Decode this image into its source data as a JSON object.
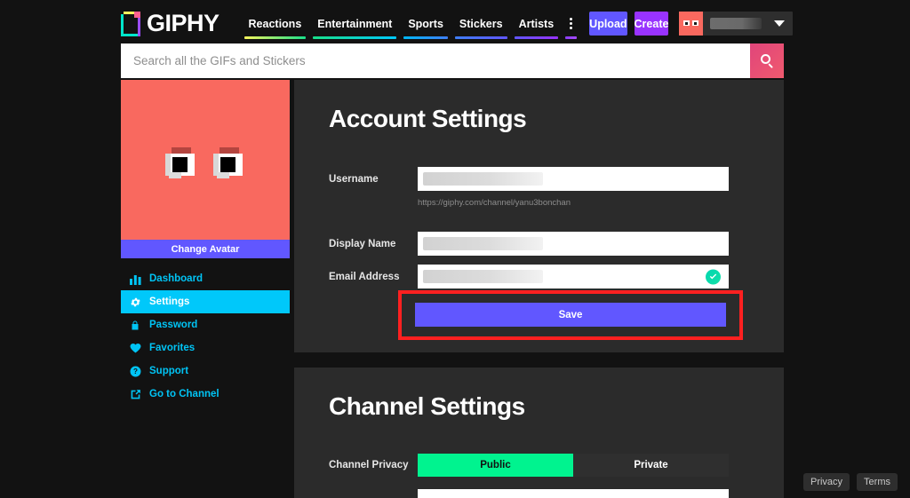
{
  "brand": {
    "logo_text": "GIPHY",
    "logo_icon": "giphy-page-logo-icon"
  },
  "nav": {
    "items": [
      {
        "label": "Reactions",
        "bar_from": "#f7f55c",
        "bar_to": "#19e08a"
      },
      {
        "label": "Entertainment",
        "bar_from": "#19e08a",
        "bar_to": "#00c8fa"
      },
      {
        "label": "Sports",
        "bar_from": "#00b7f5",
        "bar_to": "#3f7ef5"
      },
      {
        "label": "Stickers",
        "bar_from": "#3f7ef5",
        "bar_to": "#6157ff"
      },
      {
        "label": "Artists",
        "bar_from": "#6157ff",
        "bar_to": "#9933ff"
      }
    ],
    "more_icon": "more-vertical-icon",
    "more_bar_from": "#8a3df5",
    "more_bar_to": "#a84dff",
    "upload_label": "Upload",
    "create_label": "Create",
    "upload_color": "#6157ff",
    "create_color": "#9933ff",
    "user_chip": {
      "avatar_icon": "user-avatar-eyes-icon",
      "name_redacted": "",
      "chevron_icon": "chevron-down-icon"
    }
  },
  "search": {
    "placeholder": "Search all the GIFs and Stickers",
    "value": "",
    "button_icon": "search-icon",
    "accent": "#e0457b"
  },
  "sidebar": {
    "avatar": {
      "icon": "eyes-avatar-icon",
      "bg": "#f9695f"
    },
    "change_avatar_label": "Change Avatar",
    "items": [
      {
        "label": "Dashboard",
        "icon": "bar-chart-icon",
        "active": false
      },
      {
        "label": "Settings",
        "icon": "gear-icon",
        "active": true
      },
      {
        "label": "Password",
        "icon": "lock-icon",
        "active": false
      },
      {
        "label": "Favorites",
        "icon": "heart-icon",
        "active": false
      },
      {
        "label": "Support",
        "icon": "question-mark-icon",
        "active": false
      },
      {
        "label": "Go to Channel",
        "icon": "external-link-icon",
        "active": false
      }
    ],
    "active_color": "#00c8fa",
    "link_color": "#00c4f5"
  },
  "account_settings": {
    "title": "Account Settings",
    "username": {
      "label": "Username",
      "value": "",
      "redacted": true
    },
    "username_helper": "https://giphy.com/channel/yanu3bonchan",
    "display_name": {
      "label": "Display Name",
      "value": "",
      "redacted": true
    },
    "email": {
      "label": "Email Address",
      "value": "",
      "redacted": true,
      "verified": true,
      "verified_icon": "check-circle-icon"
    },
    "save_label": "Save",
    "save_color": "#6157ff",
    "highlight_color": "#ff2020"
  },
  "channel_settings": {
    "title": "Channel Settings",
    "privacy_label": "Channel Privacy",
    "privacy_options": [
      "Public",
      "Private"
    ],
    "privacy_selected": "Public",
    "selected_color": "#00f38f"
  },
  "footer": {
    "privacy_label": "Privacy",
    "terms_label": "Terms"
  }
}
